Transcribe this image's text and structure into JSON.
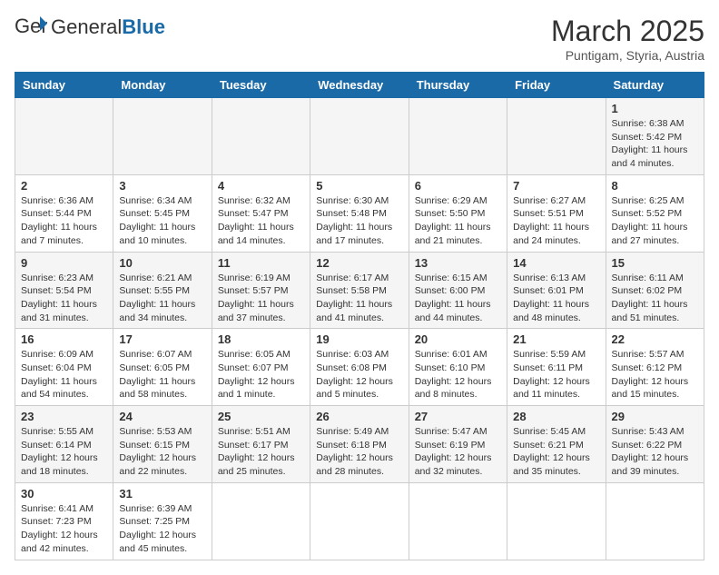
{
  "header": {
    "logo_general": "General",
    "logo_blue": "Blue",
    "month_title": "March 2025",
    "location": "Puntigam, Styria, Austria"
  },
  "days_of_week": [
    "Sunday",
    "Monday",
    "Tuesday",
    "Wednesday",
    "Thursday",
    "Friday",
    "Saturday"
  ],
  "weeks": [
    [
      {
        "day": "",
        "info": ""
      },
      {
        "day": "",
        "info": ""
      },
      {
        "day": "",
        "info": ""
      },
      {
        "day": "",
        "info": ""
      },
      {
        "day": "",
        "info": ""
      },
      {
        "day": "",
        "info": ""
      },
      {
        "day": "1",
        "info": "Sunrise: 6:38 AM\nSunset: 5:42 PM\nDaylight: 11 hours and 4 minutes."
      }
    ],
    [
      {
        "day": "2",
        "info": "Sunrise: 6:36 AM\nSunset: 5:44 PM\nDaylight: 11 hours and 7 minutes."
      },
      {
        "day": "3",
        "info": "Sunrise: 6:34 AM\nSunset: 5:45 PM\nDaylight: 11 hours and 10 minutes."
      },
      {
        "day": "4",
        "info": "Sunrise: 6:32 AM\nSunset: 5:47 PM\nDaylight: 11 hours and 14 minutes."
      },
      {
        "day": "5",
        "info": "Sunrise: 6:30 AM\nSunset: 5:48 PM\nDaylight: 11 hours and 17 minutes."
      },
      {
        "day": "6",
        "info": "Sunrise: 6:29 AM\nSunset: 5:50 PM\nDaylight: 11 hours and 21 minutes."
      },
      {
        "day": "7",
        "info": "Sunrise: 6:27 AM\nSunset: 5:51 PM\nDaylight: 11 hours and 24 minutes."
      },
      {
        "day": "8",
        "info": "Sunrise: 6:25 AM\nSunset: 5:52 PM\nDaylight: 11 hours and 27 minutes."
      }
    ],
    [
      {
        "day": "9",
        "info": "Sunrise: 6:23 AM\nSunset: 5:54 PM\nDaylight: 11 hours and 31 minutes."
      },
      {
        "day": "10",
        "info": "Sunrise: 6:21 AM\nSunset: 5:55 PM\nDaylight: 11 hours and 34 minutes."
      },
      {
        "day": "11",
        "info": "Sunrise: 6:19 AM\nSunset: 5:57 PM\nDaylight: 11 hours and 37 minutes."
      },
      {
        "day": "12",
        "info": "Sunrise: 6:17 AM\nSunset: 5:58 PM\nDaylight: 11 hours and 41 minutes."
      },
      {
        "day": "13",
        "info": "Sunrise: 6:15 AM\nSunset: 6:00 PM\nDaylight: 11 hours and 44 minutes."
      },
      {
        "day": "14",
        "info": "Sunrise: 6:13 AM\nSunset: 6:01 PM\nDaylight: 11 hours and 48 minutes."
      },
      {
        "day": "15",
        "info": "Sunrise: 6:11 AM\nSunset: 6:02 PM\nDaylight: 11 hours and 51 minutes."
      }
    ],
    [
      {
        "day": "16",
        "info": "Sunrise: 6:09 AM\nSunset: 6:04 PM\nDaylight: 11 hours and 54 minutes."
      },
      {
        "day": "17",
        "info": "Sunrise: 6:07 AM\nSunset: 6:05 PM\nDaylight: 11 hours and 58 minutes."
      },
      {
        "day": "18",
        "info": "Sunrise: 6:05 AM\nSunset: 6:07 PM\nDaylight: 12 hours and 1 minute."
      },
      {
        "day": "19",
        "info": "Sunrise: 6:03 AM\nSunset: 6:08 PM\nDaylight: 12 hours and 5 minutes."
      },
      {
        "day": "20",
        "info": "Sunrise: 6:01 AM\nSunset: 6:10 PM\nDaylight: 12 hours and 8 minutes."
      },
      {
        "day": "21",
        "info": "Sunrise: 5:59 AM\nSunset: 6:11 PM\nDaylight: 12 hours and 11 minutes."
      },
      {
        "day": "22",
        "info": "Sunrise: 5:57 AM\nSunset: 6:12 PM\nDaylight: 12 hours and 15 minutes."
      }
    ],
    [
      {
        "day": "23",
        "info": "Sunrise: 5:55 AM\nSunset: 6:14 PM\nDaylight: 12 hours and 18 minutes."
      },
      {
        "day": "24",
        "info": "Sunrise: 5:53 AM\nSunset: 6:15 PM\nDaylight: 12 hours and 22 minutes."
      },
      {
        "day": "25",
        "info": "Sunrise: 5:51 AM\nSunset: 6:17 PM\nDaylight: 12 hours and 25 minutes."
      },
      {
        "day": "26",
        "info": "Sunrise: 5:49 AM\nSunset: 6:18 PM\nDaylight: 12 hours and 28 minutes."
      },
      {
        "day": "27",
        "info": "Sunrise: 5:47 AM\nSunset: 6:19 PM\nDaylight: 12 hours and 32 minutes."
      },
      {
        "day": "28",
        "info": "Sunrise: 5:45 AM\nSunset: 6:21 PM\nDaylight: 12 hours and 35 minutes."
      },
      {
        "day": "29",
        "info": "Sunrise: 5:43 AM\nSunset: 6:22 PM\nDaylight: 12 hours and 39 minutes."
      }
    ],
    [
      {
        "day": "30",
        "info": "Sunrise: 6:41 AM\nSunset: 7:23 PM\nDaylight: 12 hours and 42 minutes."
      },
      {
        "day": "31",
        "info": "Sunrise: 6:39 AM\nSunset: 7:25 PM\nDaylight: 12 hours and 45 minutes."
      },
      {
        "day": "",
        "info": ""
      },
      {
        "day": "",
        "info": ""
      },
      {
        "day": "",
        "info": ""
      },
      {
        "day": "",
        "info": ""
      },
      {
        "day": "",
        "info": ""
      }
    ]
  ]
}
